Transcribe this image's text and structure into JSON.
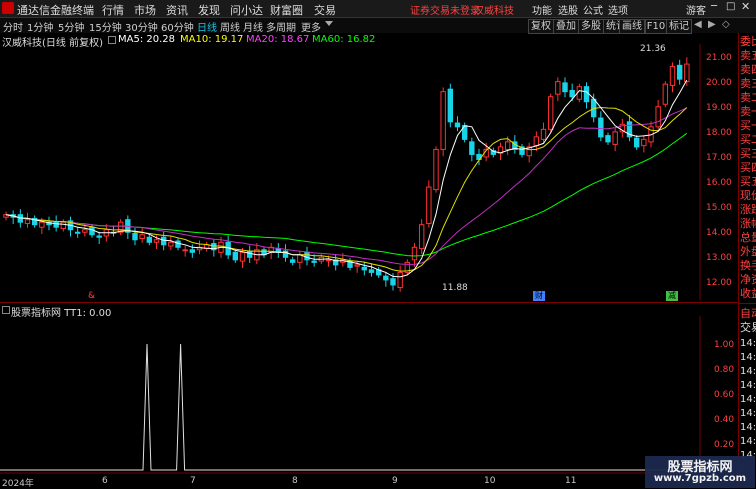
{
  "titlebar": {
    "app_name": "通达信金融终端",
    "menus": [
      "行情",
      "市场",
      "资讯",
      "发现",
      "问小达",
      "财富圈",
      "交易"
    ],
    "warning": "证券交易未登录",
    "stock_name": "汉威科技",
    "right_menus": [
      "功能",
      "选股",
      "公式",
      "选项"
    ],
    "guest": "游客"
  },
  "periodbar": {
    "items": [
      "分时",
      "1分钟",
      "5分钟",
      "15分钟",
      "30分钟",
      "60分钟",
      "日线",
      "周线",
      "月线",
      "多周期",
      "更多"
    ],
    "active_index": 6,
    "tools": [
      "复权",
      "叠加",
      "多股",
      "统计",
      "画线",
      "F10",
      "标记"
    ]
  },
  "main_info": {
    "title": "汉威科技(日线 前复权)",
    "ma5": "MA5: 20.28",
    "ma10": "MA10: 19.17",
    "ma20": "MA20: 18.67",
    "ma60": "MA60: 16.82",
    "colors": {
      "ma5": "#ffffff",
      "ma10": "#ffff00",
      "ma20": "#ff40ff",
      "ma60": "#00ff00"
    }
  },
  "price_axis": [
    "21.00",
    "20.00",
    "19.00",
    "18.00",
    "17.00",
    "16.00",
    "15.00",
    "14.00",
    "13.00",
    "12.00"
  ],
  "annotations": {
    "high": "21.36",
    "low": "11.88",
    "markers": [
      "&",
      "财",
      "减"
    ]
  },
  "sub_info": "股票指标网  TT1: 0.00",
  "sub_axis": [
    "1.00",
    "0.80",
    "0.60",
    "0.40",
    "0.20"
  ],
  "x_axis": [
    "2024年",
    "6",
    "7",
    "8",
    "9",
    "10",
    "11"
  ],
  "right_panel": {
    "labels": [
      "委比",
      "卖五",
      "卖四",
      "卖三",
      "卖二",
      "卖一",
      "买一",
      "买二",
      "买三",
      "买四",
      "买五",
      "现价",
      "涨跌",
      "涨幅",
      "总量",
      "外盘",
      "换手",
      "净资",
      "收益"
    ],
    "auto_label": "自动",
    "trade_label": "交易",
    "times": [
      "14:5",
      "14:5",
      "14:5",
      "14:5",
      "14:5",
      "14:5",
      "14:5",
      "14:5",
      "14:5"
    ]
  },
  "watermark": {
    "line1": "股票指标网",
    "line2": "www.7gpzb.com"
  },
  "chart_data": {
    "type": "candlestick",
    "title": "汉威科技(日线 前复权)",
    "ylim": [
      11.5,
      21.7
    ],
    "closes": [
      14.9,
      14.8,
      14.6,
      14.7,
      14.5,
      14.6,
      14.5,
      14.4,
      14.6,
      14.3,
      14.2,
      14.3,
      14.1,
      14.0,
      14.3,
      14.2,
      14.6,
      14.2,
      13.9,
      14.1,
      13.8,
      13.9,
      13.7,
      13.8,
      13.6,
      13.5,
      13.4,
      13.6,
      13.7,
      13.5,
      13.8,
      13.3,
      13.1,
      13.4,
      13.2,
      13.5,
      13.3,
      13.6,
      13.4,
      13.2,
      13.0,
      13.3,
      13.1,
      13.0,
      13.2,
      13.1,
      12.9,
      13.1,
      12.8,
      12.9,
      12.7,
      12.6,
      12.5,
      12.3,
      12.1,
      12.6,
      13.0,
      13.6,
      14.5,
      16.0,
      17.5,
      19.8,
      18.6,
      18.4,
      17.9,
      17.3,
      17.1,
      17.5,
      17.3,
      17.6,
      17.8,
      17.5,
      17.3,
      17.6,
      18.0,
      18.3,
      19.6,
      20.2,
      19.8,
      19.6,
      20.0,
      19.4,
      18.8,
      18.0,
      17.8,
      18.2,
      18.5,
      18.0,
      17.6,
      17.9,
      18.4,
      19.2,
      20.1,
      20.8,
      20.3,
      20.9
    ],
    "series": [
      {
        "name": "MA5",
        "value": 20.28
      },
      {
        "name": "MA10",
        "value": 19.17
      },
      {
        "name": "MA20",
        "value": 18.67
      },
      {
        "name": "MA60",
        "value": 16.82
      }
    ],
    "sub_series": {
      "name": "TT1",
      "value": 0.0,
      "peaks_at": [
        0.35,
        0.43
      ]
    }
  }
}
